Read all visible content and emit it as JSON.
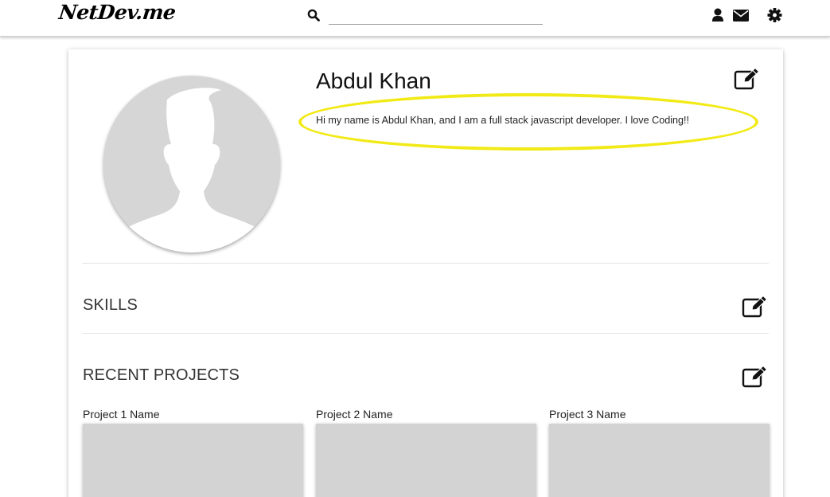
{
  "navbar": {
    "logo": "NetDev.me",
    "search_placeholder": "",
    "icons": [
      "search-icon",
      "user-icon",
      "envelope-icon",
      "gear-icon"
    ]
  },
  "profile": {
    "name": "Abdul Khan",
    "bio": "Hi my name is Abdul Khan, and I am a full stack javascript developer. I love Coding!!",
    "avatar_icon": "person-silhouette"
  },
  "sections": {
    "skills_title": "SKILLS",
    "projects_title": "RECENT PROJECTS"
  },
  "projects": [
    {
      "name": "Project 1 Name"
    },
    {
      "name": "Project 2 Name"
    },
    {
      "name": "Project 3 Name"
    }
  ],
  "colors": {
    "highlight": "#f2ea16",
    "placeholder_gray": "#d3d3d3",
    "avatar_bg": "#d6d6d6"
  }
}
